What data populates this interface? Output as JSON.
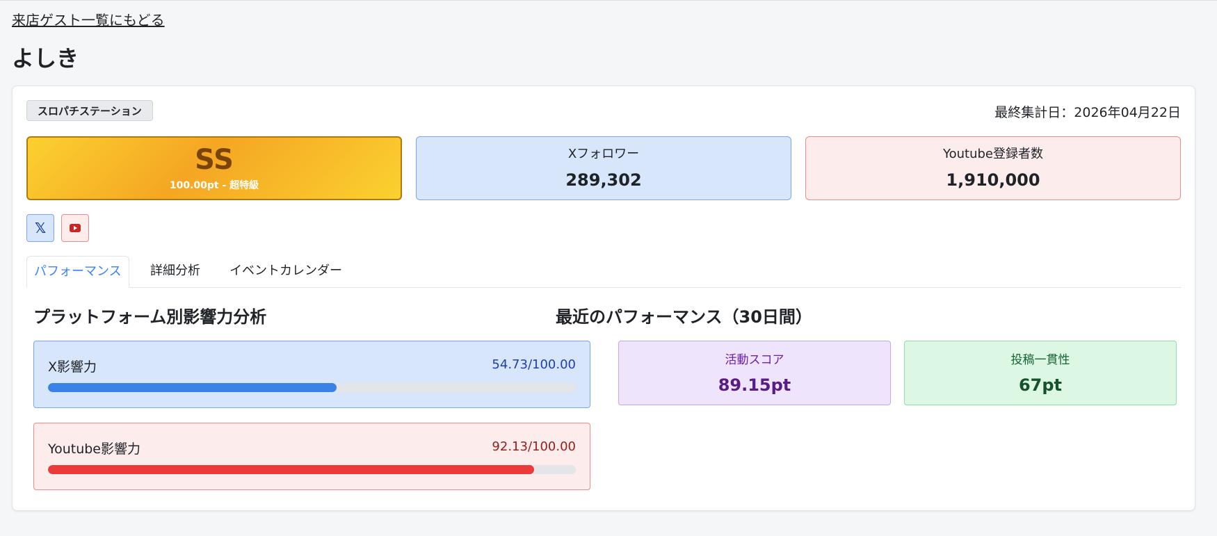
{
  "back_link": "来店ゲスト一覧にもどる",
  "guest_name": "よしき",
  "store_badge": "スロパチステーション",
  "last_aggregated": "最終集計日：2026年04月22日",
  "rank": {
    "letter": "SS",
    "subtitle": "100.00pt - 超特級"
  },
  "stats": {
    "x_followers": {
      "label": "Xフォロワー",
      "value": "289,302"
    },
    "youtube_subscribers": {
      "label": "Youtube登録者数",
      "value": "1,910,000"
    }
  },
  "social": {
    "x_icon": "𝕏",
    "x_icon_name": "x-logo-icon",
    "youtube_icon_name": "youtube-logo-icon"
  },
  "tabs": [
    {
      "label": "パフォーマンス",
      "active": true
    },
    {
      "label": "詳細分析",
      "active": false
    },
    {
      "label": "イベントカレンダー",
      "active": false
    }
  ],
  "influence": {
    "title": "プラットフォーム別影響力分析",
    "items": [
      {
        "label": "X影響力",
        "score": "54.73/100.00",
        "fraction": 0.5473
      },
      {
        "label": "Youtube影響力",
        "score": "92.13/100.00",
        "fraction": 0.9213
      }
    ]
  },
  "performance": {
    "title": "最近のパフォーマンス（30日間）",
    "activity": {
      "label": "活動スコア",
      "value": "89.15pt"
    },
    "consistency": {
      "label": "投稿一貫性",
      "value": "67pt"
    }
  },
  "colors": {
    "accent_blue": "#3b82f6",
    "x_bar": "#3b82e6",
    "youtube_bar": "#ea3a3a",
    "rank_gold": "#f5a623"
  }
}
